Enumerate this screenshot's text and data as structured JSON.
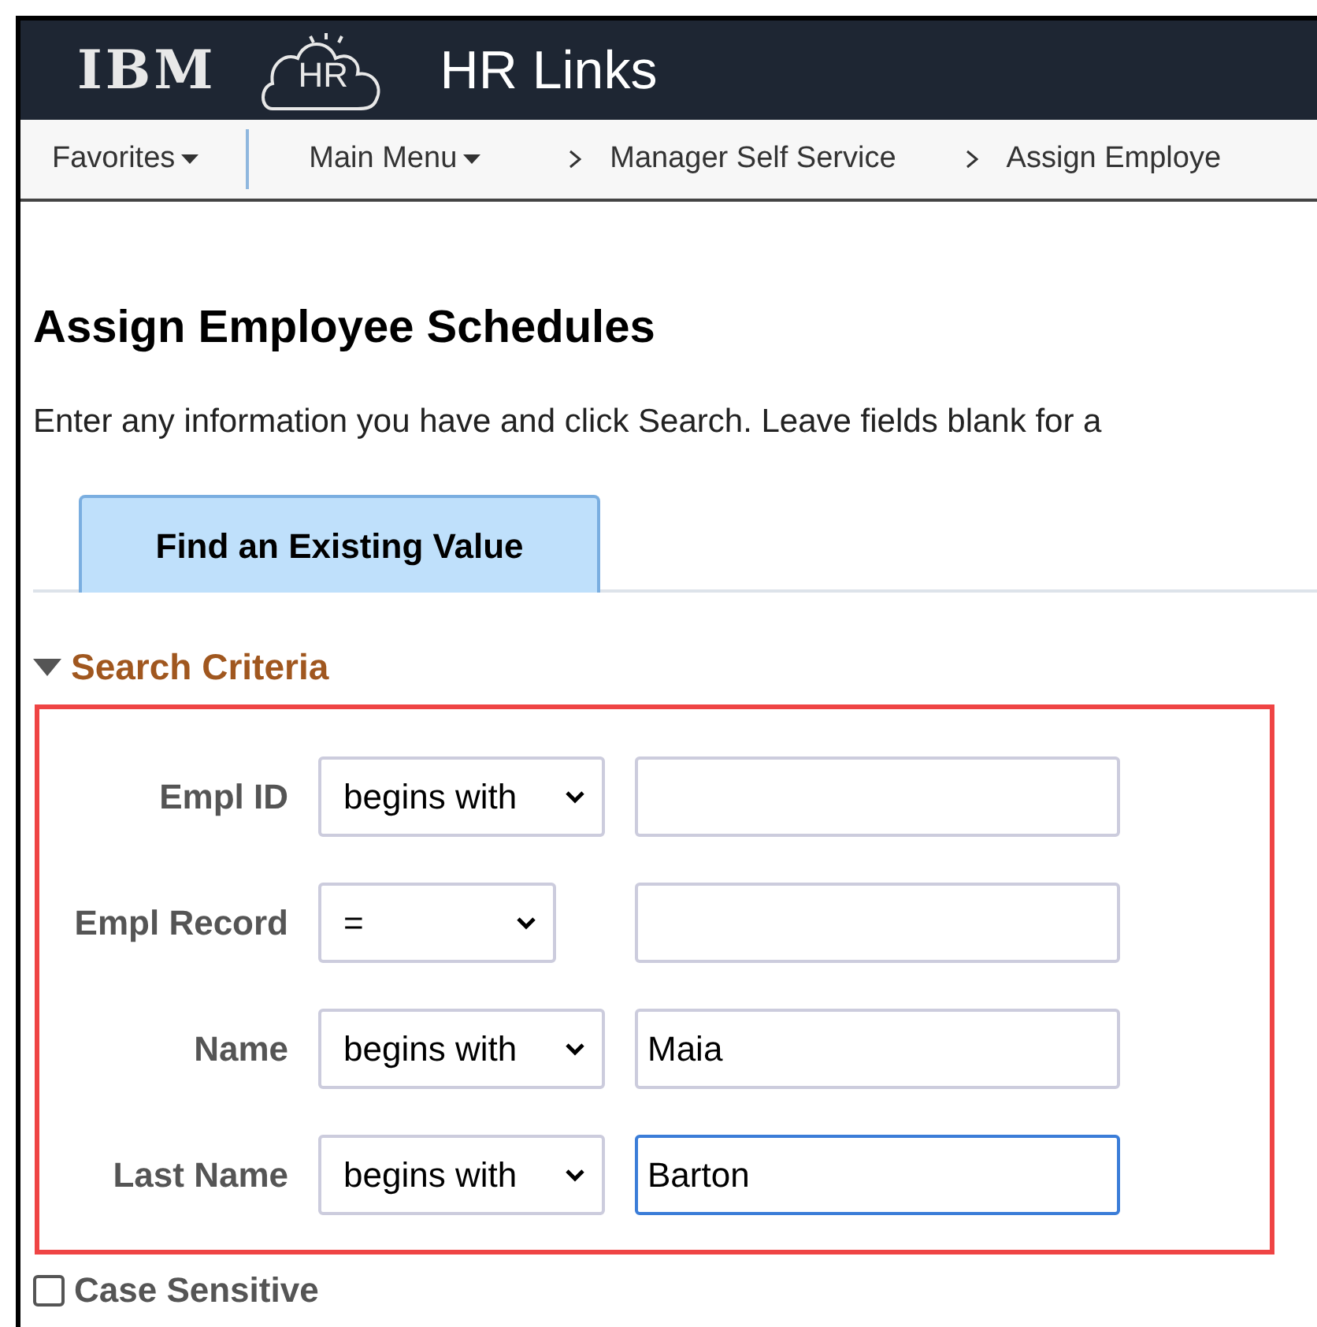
{
  "header": {
    "logo_text": "IBM",
    "app_logo_text": "HR",
    "title": "HR Links"
  },
  "breadcrumbs": [
    {
      "label": "Favorites",
      "kind": "menu"
    },
    {
      "label": "Main Menu",
      "kind": "menu"
    },
    {
      "label": "Manager Self Service",
      "kind": "crumb"
    },
    {
      "label": "Assign Employe",
      "kind": "crumb"
    }
  ],
  "page": {
    "title": "Assign Employee Schedules",
    "instructions": "Enter any information you have and click Search. Leave fields blank for a"
  },
  "tabs": [
    {
      "label": "Find an Existing Value",
      "selected": true
    }
  ],
  "section": {
    "title": "Search Criteria",
    "expanded": true
  },
  "criteria": [
    {
      "label": "Empl ID",
      "operator": "begins with",
      "focused": false
    },
    {
      "label": "Empl Record",
      "operator": "=",
      "focused": false
    },
    {
      "label": "Name",
      "operator": "begins with",
      "value": "Maia",
      "focused": false
    },
    {
      "label": "Last Name",
      "operator": "begins with",
      "value": "Barton",
      "focused": true
    }
  ],
  "case_sensitive": {
    "label": "Case Sensitive",
    "checked": false
  }
}
